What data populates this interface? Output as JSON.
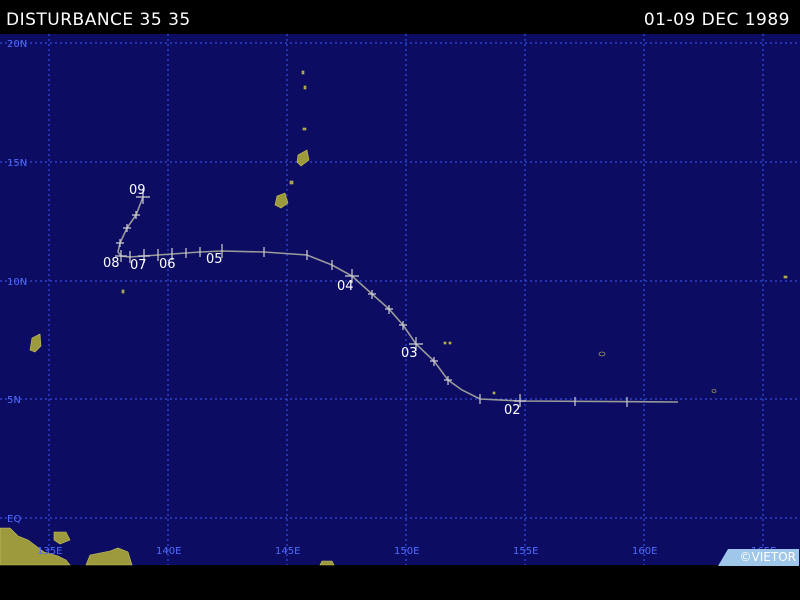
{
  "header": {
    "title": "DISTURBANCE 35 35",
    "dates": "01-09 DEC 1989"
  },
  "map": {
    "ocean_color": "#0c0c63",
    "grid_color": "#3c5bff",
    "land_color": "#9c9a3c",
    "track_color": "#9a9a9a",
    "lon_labels": [
      "135E",
      "140E",
      "145E",
      "150E",
      "155E",
      "160E",
      "165E"
    ],
    "lat_labels": [
      "20N",
      "15N",
      "10N",
      "5N",
      "EQ"
    ]
  },
  "track": {
    "day_labels": [
      {
        "text": "02",
        "lon": 154.5,
        "lat": 4.9
      },
      {
        "text": "03",
        "lon": 150.5,
        "lat": 7.2
      },
      {
        "text": "04",
        "lon": 147.7,
        "lat": 10.2
      },
      {
        "text": "05",
        "lon": 143.0,
        "lat": 11.2
      },
      {
        "text": "06",
        "lon": 140.0,
        "lat": 11.0
      },
      {
        "text": "07",
        "lon": 138.7,
        "lat": 11.0
      },
      {
        "text": "08",
        "lon": 137.5,
        "lat": 11.1
      },
      {
        "text": "09",
        "lon": 138.3,
        "lat": 13.5
      }
    ]
  },
  "copyright": "©VIETOR"
}
